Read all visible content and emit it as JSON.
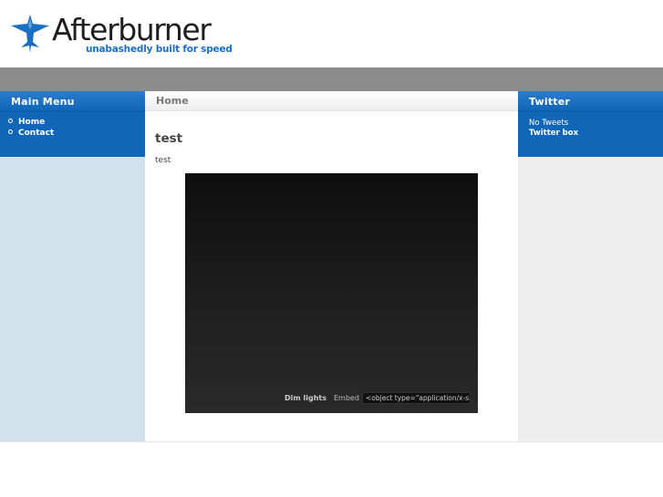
{
  "header": {
    "site_name": "Afterburner",
    "tagline": "unabashedly built for speed",
    "logo_icon": "jet-icon",
    "brand_color": "#1a6fc0"
  },
  "left_sidebar": {
    "title": "Main Menu",
    "items": [
      {
        "label": "Home"
      },
      {
        "label": "Contact"
      }
    ]
  },
  "main": {
    "breadcrumb": "Home",
    "title": "test",
    "body": "test",
    "player": {
      "dim_lights_label": "Dim lights",
      "embed_label": "Embed",
      "embed_code": "<object type=\"application/x-sh"
    }
  },
  "right_sidebar": {
    "title": "Twitter",
    "line1": "No Tweets",
    "line2": "Twitter box"
  },
  "colors": {
    "block_blue": "#1166b8",
    "band_gray": "#8c8c8c",
    "left_bg": "#d1e2ec",
    "right_bg": "#eeeeee"
  }
}
